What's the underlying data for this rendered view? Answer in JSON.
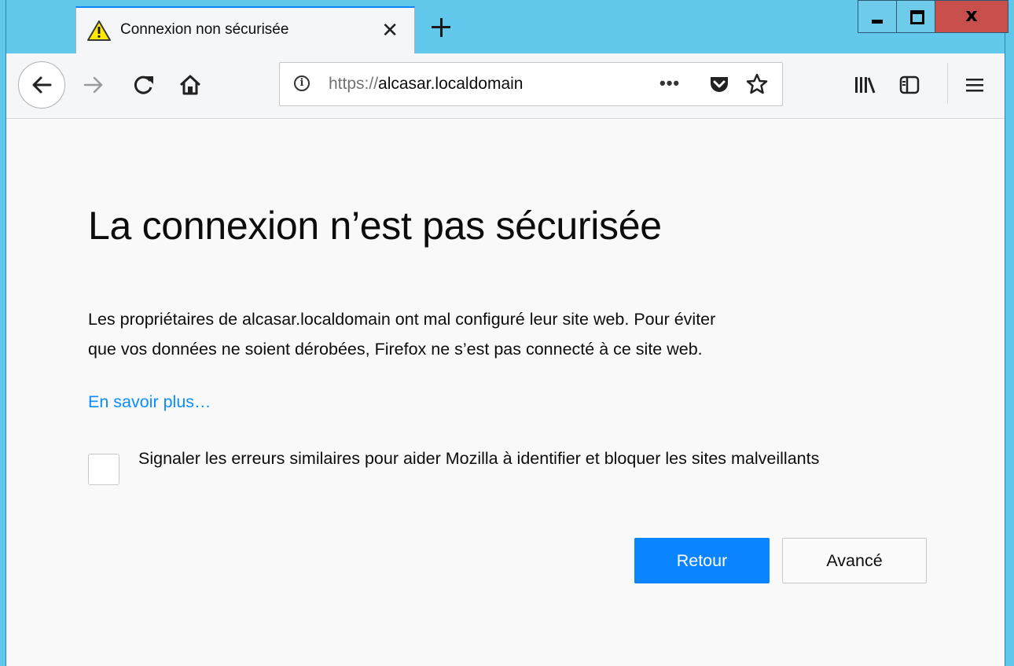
{
  "window": {
    "minimize_icon": "minimize-icon",
    "maximize_icon": "maximize-icon",
    "close_glyph": "x"
  },
  "tab": {
    "title": "Connexion non sécurisée",
    "warning_icon": "warning-triangle-icon",
    "close_glyph": "✕",
    "new_tab_icon": "plus-icon"
  },
  "toolbar": {
    "url_scheme": "https://",
    "url_host": "alcasar.localdomain",
    "page_actions_glyph": "•••",
    "icons": [
      "back-arrow-icon",
      "forward-arrow-icon",
      "reload-icon",
      "home-icon",
      "info-icon",
      "pocket-icon",
      "star-icon",
      "library-icon",
      "sidebar-icon",
      "hamburger-menu-icon"
    ]
  },
  "page": {
    "title": "La connexion n’est pas sécurisée",
    "description_line1": "Les propriétaires de alcasar.localdomain ont mal configuré leur site web. Pour éviter",
    "description_line2": "que vos données ne soient dérobées, Firefox ne s’est pas connecté à ce site web.",
    "learn_more": "En savoir plus…",
    "checkbox_label": "Signaler les erreurs similaires pour aider Mozilla à identifier et bloquer les sites malveillants",
    "checkbox_checked": false,
    "back_button": "Retour",
    "advanced_button": "Avancé"
  },
  "colors": {
    "accent": "#0a84ff",
    "link": "#0a8dff",
    "close_button": "#c7504d",
    "title_bar": "#63c9ec"
  }
}
